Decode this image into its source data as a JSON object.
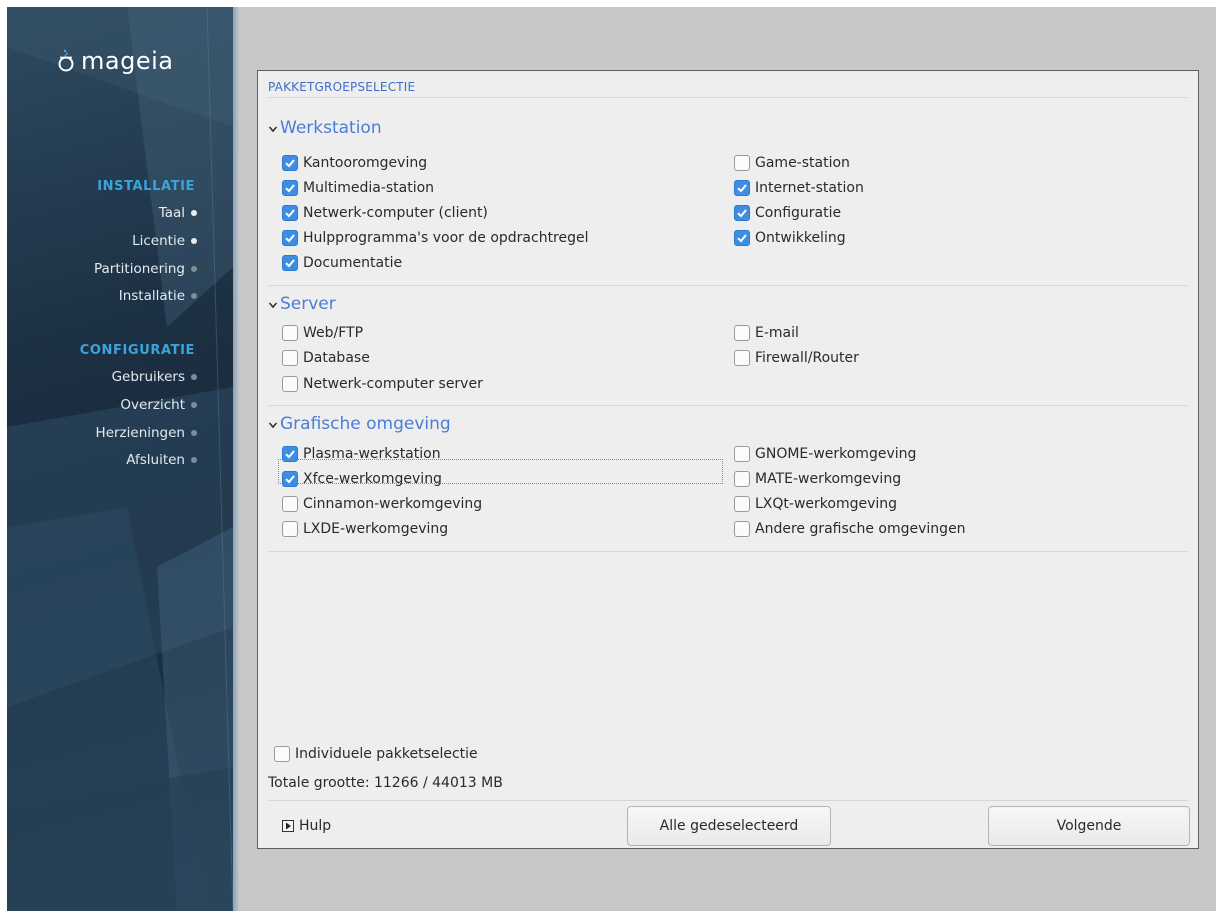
{
  "sidebar": {
    "logo_text": "mageia",
    "install_section": "INSTALLATIE",
    "install_items": [
      {
        "label": "Taal",
        "state": "done"
      },
      {
        "label": "Licentie",
        "state": "done"
      },
      {
        "label": "Partitionering",
        "state": "pending"
      },
      {
        "label": "Installatie",
        "state": "pending"
      }
    ],
    "config_section": "CONFIGURATIE",
    "config_items": [
      {
        "label": "Gebruikers",
        "state": "pending"
      },
      {
        "label": "Overzicht",
        "state": "pending"
      },
      {
        "label": "Herzieningen",
        "state": "pending"
      },
      {
        "label": "Afsluiten",
        "state": "pending"
      }
    ]
  },
  "panel": {
    "title": "PAKKETGROEPSELECTIE",
    "groups": {
      "workstation": {
        "title": "Werkstation",
        "items": [
          {
            "label": "Kantooromgeving",
            "checked": true
          },
          {
            "label": "Game-station",
            "checked": false
          },
          {
            "label": "Multimedia-station",
            "checked": true
          },
          {
            "label": "Internet-station",
            "checked": true
          },
          {
            "label": "Netwerk-computer (client)",
            "checked": true
          },
          {
            "label": "Configuratie",
            "checked": true
          },
          {
            "label": "Hulpprogramma's voor de opdrachtregel",
            "checked": true
          },
          {
            "label": "Ontwikkeling",
            "checked": true
          },
          {
            "label": "Documentatie",
            "checked": true
          }
        ]
      },
      "server": {
        "title": "Server",
        "items": [
          {
            "label": "Web/FTP",
            "checked": false
          },
          {
            "label": "E-mail",
            "checked": false
          },
          {
            "label": "Database",
            "checked": false
          },
          {
            "label": "Firewall/Router",
            "checked": false
          },
          {
            "label": "Netwerk-computer server",
            "checked": false
          }
        ]
      },
      "graphical": {
        "title": "Grafische omgeving",
        "items": [
          {
            "label": "Plasma-werkstation",
            "checked": true
          },
          {
            "label": "GNOME-werkomgeving",
            "checked": false
          },
          {
            "label": "Xfce-werkomgeving",
            "checked": true
          },
          {
            "label": "MATE-werkomgeving",
            "checked": false
          },
          {
            "label": "Cinnamon-werkomgeving",
            "checked": false
          },
          {
            "label": "LXQt-werkomgeving",
            "checked": false
          },
          {
            "label": "LXDE-werkomgeving",
            "checked": false
          },
          {
            "label": "Andere grafische omgevingen",
            "checked": false
          }
        ]
      }
    },
    "individual_selection": {
      "label": "Individuele pakketselectie",
      "checked": false
    },
    "total_size": "Totale grootte: 11266 / 44013 MB",
    "help_label": "Hulp",
    "deselect_all_label": "Alle gedeselecteerd",
    "next_label": "Volgende"
  },
  "colors": {
    "accent": "#3d8ee3",
    "group_title": "#4a7dd6",
    "sidebar_section": "#3aa5dc"
  }
}
